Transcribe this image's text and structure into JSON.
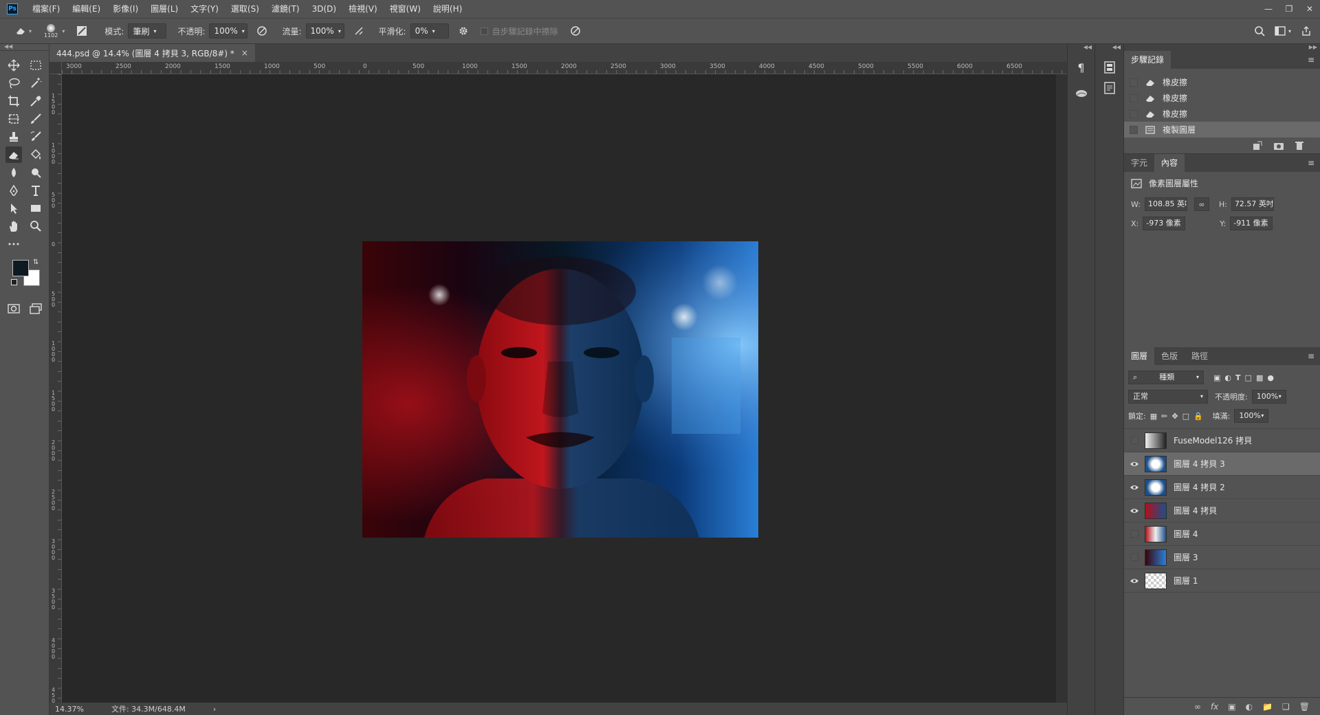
{
  "app": {
    "logo": "Ps"
  },
  "menu": [
    "檔案(F)",
    "編輯(E)",
    "影像(I)",
    "圖層(L)",
    "文字(Y)",
    "選取(S)",
    "濾鏡(T)",
    "3D(D)",
    "檢視(V)",
    "視窗(W)",
    "說明(H)"
  ],
  "options": {
    "brush_size": "1102",
    "mode_label": "模式:",
    "mode_value": "筆刷",
    "opacity_label": "不透明:",
    "opacity_value": "100%",
    "flow_label": "流量:",
    "flow_value": "100%",
    "smoothing_label": "平滑化:",
    "smoothing_value": "0%",
    "erase_history_label": "自步驟記錄中擦除"
  },
  "document": {
    "tab_title": "444.psd @ 14.4% (圖層 4 拷貝 3, RGB/8#) *",
    "close": "×"
  },
  "ruler_h": [
    "3000",
    "2500",
    "2000",
    "1500",
    "1000",
    "500",
    "0",
    "500",
    "1000",
    "1500",
    "2000",
    "2500",
    "3000",
    "3500",
    "4000",
    "4500",
    "5000",
    "5500",
    "6000",
    "6500"
  ],
  "ruler_v": [
    "1500",
    "1000",
    "500",
    "0",
    "500",
    "1000",
    "1500",
    "2000",
    "2500",
    "3000",
    "3500",
    "4000",
    "4500"
  ],
  "status": {
    "zoom": "14.37%",
    "doc": "文件: 34.3M/648.4M",
    "arrow": "›"
  },
  "history": {
    "tab": "步驟記錄",
    "items": [
      {
        "label": "橡皮擦",
        "icon": "eraser-icon"
      },
      {
        "label": "橡皮擦",
        "icon": "eraser-icon"
      },
      {
        "label": "橡皮擦",
        "icon": "eraser-icon"
      },
      {
        "label": "複製圖層",
        "icon": "layer-icon"
      }
    ]
  },
  "properties": {
    "tabs": [
      "字元",
      "內容"
    ],
    "title": "像素圖層屬性",
    "w_label": "W:",
    "w_value": "108.85 英吋",
    "h_label": "H:",
    "h_value": "72.57 英吋",
    "x_label": "X:",
    "x_value": "-973 像素",
    "y_label": "Y:",
    "y_value": "-911 像素"
  },
  "layers_panel": {
    "tabs": [
      "圖層",
      "色版",
      "路徑"
    ],
    "filter_value": "種類",
    "blend_mode": "正常",
    "opacity_label": "不透明度:",
    "opacity_value": "100%",
    "lock_label": "鎖定:",
    "fill_label": "填滿:",
    "fill_value": "100%",
    "layers": [
      {
        "name": "FuseModel126 拷貝",
        "visible": false,
        "selected": false
      },
      {
        "name": "圖層 4 拷貝 3",
        "visible": true,
        "selected": true
      },
      {
        "name": "圖層 4 拷貝 2",
        "visible": true,
        "selected": false
      },
      {
        "name": "圖層 4 拷貝",
        "visible": true,
        "selected": false
      },
      {
        "name": "圖層 4",
        "visible": false,
        "selected": false
      },
      {
        "name": "圖層 3",
        "visible": false,
        "selected": false
      },
      {
        "name": "圖層 1",
        "visible": true,
        "selected": false
      }
    ]
  },
  "colors": {
    "foreground": "#0e1a22",
    "background": "#ffffff",
    "accent": "#31a8ff"
  }
}
